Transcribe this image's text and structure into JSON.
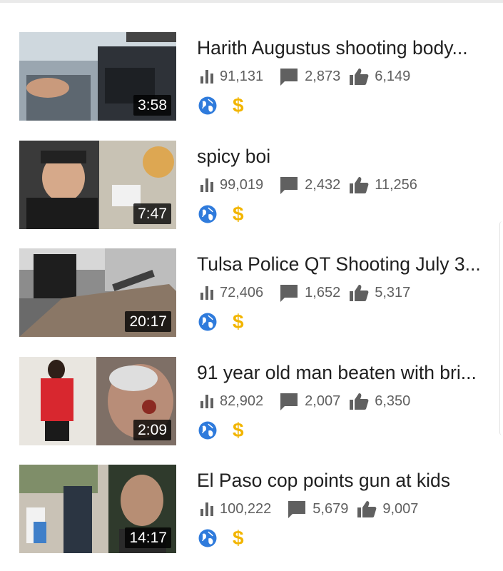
{
  "colors": {
    "accent_blue": "#2f7bdc",
    "dollar_gold": "#f2b500",
    "meta_gray": "#606060",
    "title_text": "#202020"
  },
  "icons": {
    "views": "bar-chart-icon",
    "comments": "comment-icon",
    "likes": "thumbs-up-icon",
    "visibility": "globe-icon",
    "monetization": "dollar-icon"
  },
  "videos": [
    {
      "title": "Harith Augustus shooting body...",
      "duration": "3:58",
      "views": "91,131",
      "comments": "2,873",
      "likes": "6,149",
      "monetization": "$"
    },
    {
      "title": "spicy boi",
      "duration": "7:47",
      "views": "99,019",
      "comments": "2,432",
      "likes": "11,256",
      "monetization": "$"
    },
    {
      "title": "Tulsa Police QT Shooting July 3...",
      "duration": "20:17",
      "views": "72,406",
      "comments": "1,652",
      "likes": "5,317",
      "monetization": "$"
    },
    {
      "title": "91 year old man beaten with bri...",
      "duration": "2:09",
      "views": "82,902",
      "comments": "2,007",
      "likes": "6,350",
      "monetization": "$"
    },
    {
      "title": "El Paso cop points gun at kids",
      "duration": "14:17",
      "views": "100,222",
      "comments": "5,679",
      "likes": "9,007",
      "monetization": "$"
    }
  ]
}
